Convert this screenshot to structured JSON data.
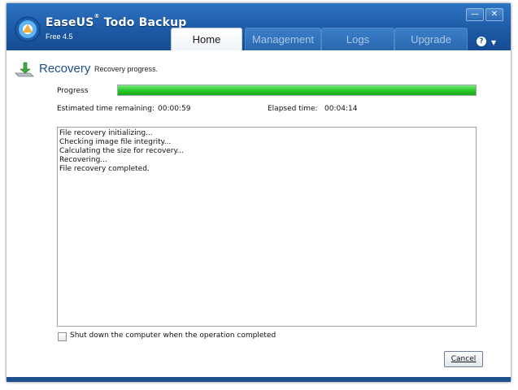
{
  "app": {
    "brand_part1": "EaseUS",
    "brand_reg": "®",
    "brand_part2": " Todo Backup",
    "version": "Free 4.5",
    "logo_icon": "easeus-logo-icon"
  },
  "tabs": [
    {
      "label": "Home",
      "active": true
    },
    {
      "label": "Management",
      "active": false
    },
    {
      "label": "Logs",
      "active": false
    },
    {
      "label": "Upgrade",
      "active": false
    }
  ],
  "window_controls": {
    "minimize_glyph": "—",
    "close_glyph": "✕",
    "help_glyph": "?",
    "help_menu_glyph": "▼"
  },
  "page": {
    "title": "Recovery",
    "subtitle": "Recovery progress.",
    "icon": "recovery-arrow-drive-icon"
  },
  "progress": {
    "label": "Progress",
    "fraction": 1.0,
    "bar_color": "#2fcf2f"
  },
  "times": {
    "remaining_label": "Estimated time remaining:",
    "remaining_value": "00:00:59",
    "elapsed_label": "Elapsed time:",
    "elapsed_value": "00:04:14"
  },
  "log_lines": [
    "File recovery initializing...",
    "Checking image file integrity...",
    "Calculating the size for recovery...",
    "Recovering...",
    "File recovery completed."
  ],
  "shutdown_option": {
    "label": "Shut down the computer when the operation completed",
    "checked": false
  },
  "cancel_button": {
    "label": "Cancel"
  },
  "colors": {
    "titlebar": "#1d5aa5",
    "title_text": "#1c4e88",
    "inactive_tab_text": "#aac8ea"
  }
}
